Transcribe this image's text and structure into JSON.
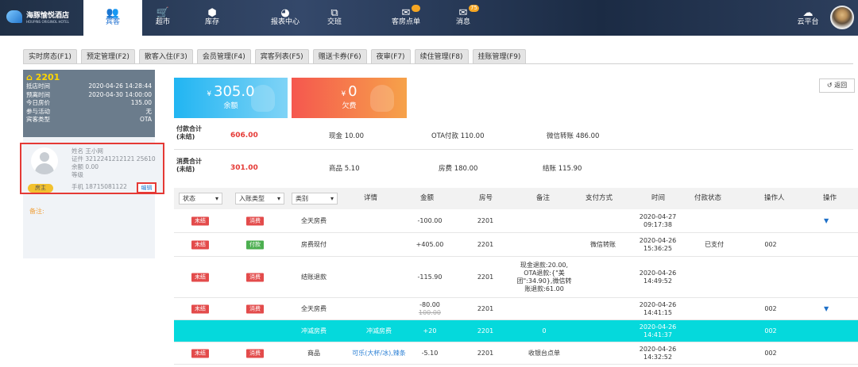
{
  "header": {
    "logo_name": "海豚愉悦酒店",
    "logo_sub": "HOUPINS ORIGINOL HOTEL",
    "nav": [
      {
        "label": "宾客",
        "icon": "users-icon",
        "glyph": "👥",
        "active": true
      },
      {
        "label": "超市",
        "icon": "cart-icon",
        "glyph": "🛒"
      },
      {
        "label": "库存",
        "icon": "box-icon",
        "glyph": "⬢"
      },
      {
        "label": "报表中心",
        "icon": "chart-pie-icon",
        "glyph": "◕"
      },
      {
        "label": "交班",
        "icon": "shift-icon",
        "glyph": "⧉"
      },
      {
        "label": "客房点单",
        "icon": "order-icon",
        "glyph": "✉",
        "badge": ""
      },
      {
        "label": "消息",
        "icon": "message-icon",
        "glyph": "✉",
        "badge": "75"
      },
      {
        "label": "云平台",
        "icon": "cloud-upload-icon",
        "glyph": "☁"
      }
    ]
  },
  "tabs": [
    "实时房态(F1)",
    "预定管理(F2)",
    "散客入住(F3)",
    "会员管理(F4)",
    "宾客列表(F5)",
    "赠送卡券(F6)",
    "夜审(F7)",
    "续住管理(F8)",
    "挂账管理(F9)"
  ],
  "room": {
    "number": "2201",
    "rows": [
      {
        "k": "抵店时间",
        "v": "2020-04-26 14:28:44"
      },
      {
        "k": "预离时间",
        "v": "2020-04-30 14:00:00"
      },
      {
        "k": "今日房价",
        "v": "135.00"
      },
      {
        "k": "参与活动",
        "v": "无"
      },
      {
        "k": "宾客类型",
        "v": "OTA"
      }
    ]
  },
  "guest": {
    "name": "姓名  王小网",
    "id": "证件  3212241212121 25610",
    "balance": "余额  0.00",
    "level": "等级",
    "phone": "手机  18715081122",
    "role": "房主",
    "edit": "编辑"
  },
  "remark_label": "备注:",
  "cards": {
    "balance": {
      "currency": "¥",
      "amount": "305.0",
      "caption": "余额"
    },
    "owed": {
      "currency": "¥",
      "amount": "0",
      "caption": "欠费"
    }
  },
  "back_label": "返回",
  "summary": {
    "pay_label": "付款合计",
    "pay_sub": "(未结)",
    "pay_total": "606.00",
    "pay_items": [
      "现金 10.00",
      "OTA付款 110.00",
      "微信转账 486.00"
    ],
    "cons_label": "消费合计",
    "cons_sub": "(未结)",
    "cons_total": "301.00",
    "cons_items": [
      "商品 5.10",
      "房费 180.00",
      "结账 115.90"
    ]
  },
  "table": {
    "filters": [
      "状态",
      "入账类型",
      "类别"
    ],
    "headers": [
      "详情",
      "金额",
      "房号",
      "备注",
      "支付方式",
      "时间",
      "付款状态",
      "操作人",
      "操作"
    ],
    "rows": [
      {
        "status": "未结",
        "type": "消费",
        "type_color": "red",
        "category": "全天房费",
        "detail": "",
        "amount": "-100.00",
        "amount_old": "",
        "room": "2201",
        "remark": "",
        "pay": "",
        "time": "2020-04-27\n09:17:38",
        "pstatus": "",
        "op": "",
        "caret": true
      },
      {
        "status": "未结",
        "type": "付款",
        "type_color": "green",
        "category": "房费现付",
        "detail": "",
        "amount": "+405.00",
        "amount_old": "",
        "room": "2201",
        "remark": "",
        "pay": "微信转账",
        "time": "2020-04-26\n15:36:25",
        "pstatus": "已支付",
        "op": "002",
        "caret": false
      },
      {
        "status": "未结",
        "type": "消费",
        "type_color": "red",
        "category": "结账退款",
        "detail": "",
        "amount": "-115.90",
        "amount_old": "",
        "room": "2201",
        "remark": "现金退款:20.00,\nOTA退款:{\"美\n团\":34.90},微信转\n账退款:61.00",
        "pay": "",
        "time": "2020-04-26\n14:49:52",
        "pstatus": "",
        "op": "",
        "caret": false
      },
      {
        "status": "未结",
        "type": "消费",
        "type_color": "red",
        "category": "全天房费",
        "detail": "",
        "amount": "-80.00",
        "amount_old": "100.00",
        "room": "2201",
        "remark": "",
        "pay": "",
        "time": "2020-04-26\n14:41:15",
        "pstatus": "",
        "op": "002",
        "caret": true
      },
      {
        "status": "",
        "type": "",
        "type_color": "",
        "category": "冲减房费",
        "detail": "冲减房费",
        "amount": "+20",
        "amount_old": "",
        "room": "2201",
        "remark": "0",
        "pay": "",
        "time": "2020-04-26\n14:41:37",
        "pstatus": "",
        "op": "002",
        "caret": false,
        "highlight": true
      },
      {
        "status": "未结",
        "type": "消费",
        "type_color": "red",
        "category": "商品",
        "detail": "可乐(大杯/冰),辣条",
        "amount": "-5.10",
        "amount_old": "",
        "room": "2201",
        "remark": "收银台点单",
        "pay": "",
        "time": "2020-04-26\n14:32:52",
        "pstatus": "",
        "op": "002",
        "caret": false
      }
    ]
  }
}
